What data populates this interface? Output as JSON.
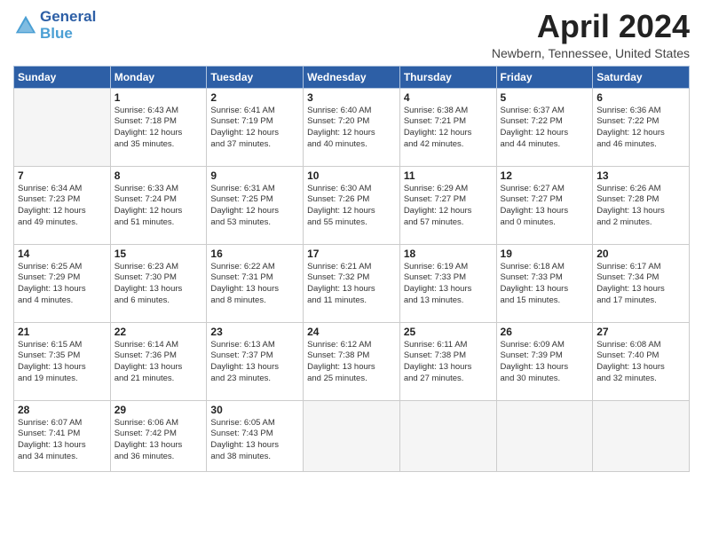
{
  "header": {
    "logo_general": "General",
    "logo_blue": "Blue",
    "month_title": "April 2024",
    "location": "Newbern, Tennessee, United States"
  },
  "days_of_week": [
    "Sunday",
    "Monday",
    "Tuesday",
    "Wednesday",
    "Thursday",
    "Friday",
    "Saturday"
  ],
  "weeks": [
    [
      {
        "day": "",
        "info": ""
      },
      {
        "day": "1",
        "info": "Sunrise: 6:43 AM\nSunset: 7:18 PM\nDaylight: 12 hours\nand 35 minutes."
      },
      {
        "day": "2",
        "info": "Sunrise: 6:41 AM\nSunset: 7:19 PM\nDaylight: 12 hours\nand 37 minutes."
      },
      {
        "day": "3",
        "info": "Sunrise: 6:40 AM\nSunset: 7:20 PM\nDaylight: 12 hours\nand 40 minutes."
      },
      {
        "day": "4",
        "info": "Sunrise: 6:38 AM\nSunset: 7:21 PM\nDaylight: 12 hours\nand 42 minutes."
      },
      {
        "day": "5",
        "info": "Sunrise: 6:37 AM\nSunset: 7:22 PM\nDaylight: 12 hours\nand 44 minutes."
      },
      {
        "day": "6",
        "info": "Sunrise: 6:36 AM\nSunset: 7:22 PM\nDaylight: 12 hours\nand 46 minutes."
      }
    ],
    [
      {
        "day": "7",
        "info": "Sunrise: 6:34 AM\nSunset: 7:23 PM\nDaylight: 12 hours\nand 49 minutes."
      },
      {
        "day": "8",
        "info": "Sunrise: 6:33 AM\nSunset: 7:24 PM\nDaylight: 12 hours\nand 51 minutes."
      },
      {
        "day": "9",
        "info": "Sunrise: 6:31 AM\nSunset: 7:25 PM\nDaylight: 12 hours\nand 53 minutes."
      },
      {
        "day": "10",
        "info": "Sunrise: 6:30 AM\nSunset: 7:26 PM\nDaylight: 12 hours\nand 55 minutes."
      },
      {
        "day": "11",
        "info": "Sunrise: 6:29 AM\nSunset: 7:27 PM\nDaylight: 12 hours\nand 57 minutes."
      },
      {
        "day": "12",
        "info": "Sunrise: 6:27 AM\nSunset: 7:27 PM\nDaylight: 13 hours\nand 0 minutes."
      },
      {
        "day": "13",
        "info": "Sunrise: 6:26 AM\nSunset: 7:28 PM\nDaylight: 13 hours\nand 2 minutes."
      }
    ],
    [
      {
        "day": "14",
        "info": "Sunrise: 6:25 AM\nSunset: 7:29 PM\nDaylight: 13 hours\nand 4 minutes."
      },
      {
        "day": "15",
        "info": "Sunrise: 6:23 AM\nSunset: 7:30 PM\nDaylight: 13 hours\nand 6 minutes."
      },
      {
        "day": "16",
        "info": "Sunrise: 6:22 AM\nSunset: 7:31 PM\nDaylight: 13 hours\nand 8 minutes."
      },
      {
        "day": "17",
        "info": "Sunrise: 6:21 AM\nSunset: 7:32 PM\nDaylight: 13 hours\nand 11 minutes."
      },
      {
        "day": "18",
        "info": "Sunrise: 6:19 AM\nSunset: 7:33 PM\nDaylight: 13 hours\nand 13 minutes."
      },
      {
        "day": "19",
        "info": "Sunrise: 6:18 AM\nSunset: 7:33 PM\nDaylight: 13 hours\nand 15 minutes."
      },
      {
        "day": "20",
        "info": "Sunrise: 6:17 AM\nSunset: 7:34 PM\nDaylight: 13 hours\nand 17 minutes."
      }
    ],
    [
      {
        "day": "21",
        "info": "Sunrise: 6:15 AM\nSunset: 7:35 PM\nDaylight: 13 hours\nand 19 minutes."
      },
      {
        "day": "22",
        "info": "Sunrise: 6:14 AM\nSunset: 7:36 PM\nDaylight: 13 hours\nand 21 minutes."
      },
      {
        "day": "23",
        "info": "Sunrise: 6:13 AM\nSunset: 7:37 PM\nDaylight: 13 hours\nand 23 minutes."
      },
      {
        "day": "24",
        "info": "Sunrise: 6:12 AM\nSunset: 7:38 PM\nDaylight: 13 hours\nand 25 minutes."
      },
      {
        "day": "25",
        "info": "Sunrise: 6:11 AM\nSunset: 7:38 PM\nDaylight: 13 hours\nand 27 minutes."
      },
      {
        "day": "26",
        "info": "Sunrise: 6:09 AM\nSunset: 7:39 PM\nDaylight: 13 hours\nand 30 minutes."
      },
      {
        "day": "27",
        "info": "Sunrise: 6:08 AM\nSunset: 7:40 PM\nDaylight: 13 hours\nand 32 minutes."
      }
    ],
    [
      {
        "day": "28",
        "info": "Sunrise: 6:07 AM\nSunset: 7:41 PM\nDaylight: 13 hours\nand 34 minutes."
      },
      {
        "day": "29",
        "info": "Sunrise: 6:06 AM\nSunset: 7:42 PM\nDaylight: 13 hours\nand 36 minutes."
      },
      {
        "day": "30",
        "info": "Sunrise: 6:05 AM\nSunset: 7:43 PM\nDaylight: 13 hours\nand 38 minutes."
      },
      {
        "day": "",
        "info": ""
      },
      {
        "day": "",
        "info": ""
      },
      {
        "day": "",
        "info": ""
      },
      {
        "day": "",
        "info": ""
      }
    ]
  ]
}
